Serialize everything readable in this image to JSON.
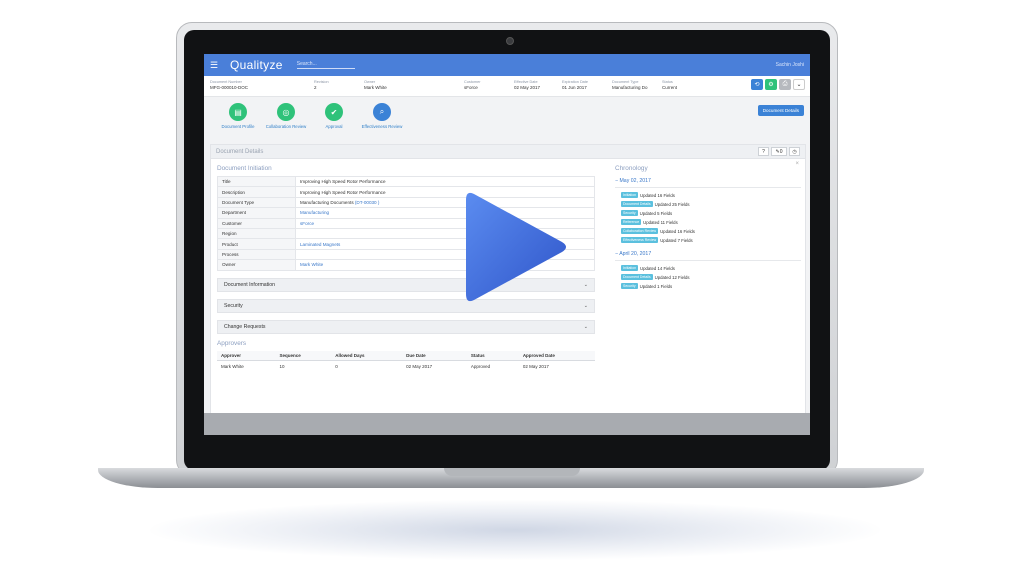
{
  "app": {
    "brand": "Qualityze",
    "search_placeholder": "Search...",
    "user": "Sachin Joshi"
  },
  "info": [
    {
      "key": "Document Number",
      "value": "MFG-000010-DOC"
    },
    {
      "key": "Revision",
      "value": "2"
    },
    {
      "key": "Owner",
      "value": "Mark White"
    },
    {
      "key": "Customer",
      "value": "sForce"
    },
    {
      "key": "Effective Date",
      "value": "02 May 2017"
    },
    {
      "key": "Expiration Date",
      "value": "01 Jun 2017"
    },
    {
      "key": "Document Type",
      "value": "Manufacturing Do"
    },
    {
      "key": "Status",
      "value": "Current"
    }
  ],
  "workflow": [
    {
      "label": "Document Profile",
      "color": "#2fc27a",
      "icon": "document-icon"
    },
    {
      "label": "Collaboration Review",
      "color": "#2fc27a",
      "icon": "review-icon"
    },
    {
      "label": "Approval",
      "color": "#2fc27a",
      "icon": "approval-icon"
    },
    {
      "label": "Effectiveness Review",
      "color": "#3b82d6",
      "icon": "search-icon"
    }
  ],
  "doc_details_button": "Document Details",
  "panel": {
    "title": "Document Details",
    "help": "?",
    "attach_count": "0"
  },
  "initiation": {
    "title": "Document Initiation",
    "rows": [
      {
        "k": "Title",
        "v": "Improving High Speed Rotor Performance"
      },
      {
        "k": "Description",
        "v": "Improving High Speed Rotor Performance"
      },
      {
        "k": "Document Type",
        "v": "Manufacturing Documents",
        "v2": "(DT-00030 )"
      },
      {
        "k": "Department",
        "v": "Manufacturing"
      },
      {
        "k": "Customer",
        "v": "sForce"
      },
      {
        "k": "Region",
        "v": ""
      },
      {
        "k": "Product",
        "v": "Laminated Magnets"
      },
      {
        "k": "Process",
        "v": ""
      },
      {
        "k": "Owner",
        "v": "Mark White"
      }
    ]
  },
  "accordions": [
    "Document Information",
    "Security",
    "Change Requests"
  ],
  "approvers": {
    "title": "Approvers",
    "headers": [
      "Approver",
      "Sequence",
      "Allowed Days",
      "Due Date",
      "Status",
      "Approved Date"
    ],
    "rows": [
      [
        "Mark White",
        "10",
        "0",
        "02 May 2017",
        "Approved",
        "02 May 2017"
      ]
    ]
  },
  "chronology": {
    "title": "Chronology",
    "groups": [
      {
        "date": "May 02, 2017",
        "entries": [
          {
            "tag": "Initiation",
            "text": "Updated 16 Fields"
          },
          {
            "tag": "Document Details",
            "text": "Updated 25 Fields"
          },
          {
            "tag": "Security",
            "text": "Updated 5 Fields"
          },
          {
            "tag": "Reference",
            "text": "Updated 11 Fields"
          },
          {
            "tag": "Collaboration Review",
            "text": "Updated 16 Fields"
          },
          {
            "tag": "Effectiveness Review",
            "text": "Updated 7 Fields"
          }
        ]
      },
      {
        "date": "April 20, 2017",
        "entries": [
          {
            "tag": "Initiation",
            "text": "Updated 14 Fields"
          },
          {
            "tag": "Document Details",
            "text": "Updated 12 Fields"
          },
          {
            "tag": "Security",
            "text": "Updated 1 Fields"
          }
        ]
      }
    ]
  },
  "colors": {
    "topbar": "#4a7fd9",
    "link": "#3a78c9",
    "tag": "#5bc0de",
    "play": "#3b63d6"
  }
}
